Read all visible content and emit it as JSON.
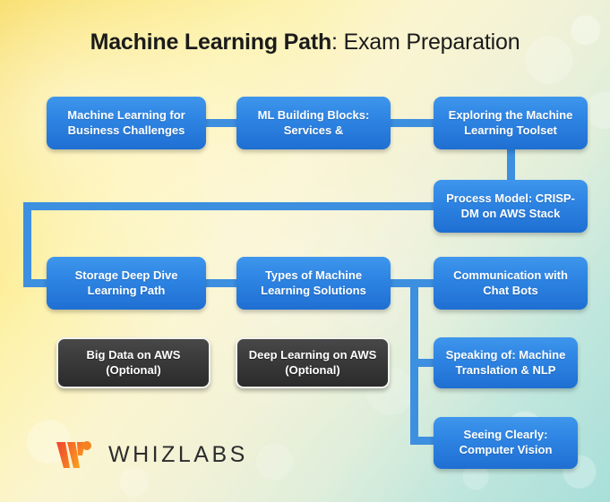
{
  "title": {
    "bold_part": "Machine Learning Path",
    "light_part": ": Exam Preparation"
  },
  "nodes": [
    {
      "id": "ml-business-challenges",
      "label": "Machine Learning for Business Challenges",
      "style": "blue"
    },
    {
      "id": "ml-building-blocks",
      "label": "ML Building Blocks: Services &",
      "style": "blue"
    },
    {
      "id": "exploring-ml-toolset",
      "label": "Exploring the Machine Learning Toolset",
      "style": "blue"
    },
    {
      "id": "process-model-crisp-dm",
      "label": "Process Model: CRISP-DM on AWS Stack",
      "style": "blue"
    },
    {
      "id": "storage-deep-dive",
      "label": "Storage Deep Dive Learning Path",
      "style": "blue"
    },
    {
      "id": "types-of-ml-solutions",
      "label": "Types of Machine Learning Solutions",
      "style": "blue"
    },
    {
      "id": "communication-chat-bots",
      "label": "Communication with Chat Bots",
      "style": "blue"
    },
    {
      "id": "big-data-on-aws",
      "label": "Big Data on AWS (Optional)",
      "style": "dark"
    },
    {
      "id": "deep-learning-on-aws",
      "label": "Deep Learning on AWS (Optional)",
      "style": "dark"
    },
    {
      "id": "machine-translation-nlp",
      "label": "Speaking of: Machine Translation & NLP",
      "style": "blue"
    },
    {
      "id": "computer-vision",
      "label": "Seeing Clearly: Computer Vision",
      "style": "blue"
    }
  ],
  "logo": {
    "name": "WHIZLABS",
    "mark": "whizlabs-w-mark"
  },
  "colors": {
    "node_blue_top": "#3f96ec",
    "node_blue_bottom": "#1f6fd2",
    "connector_blue": "#3d8fe0",
    "node_dark": "#3a3a3a",
    "title_text": "#1b1b1b",
    "bg_yellow": "#f6d851",
    "bg_teal": "#a8dfd9"
  }
}
